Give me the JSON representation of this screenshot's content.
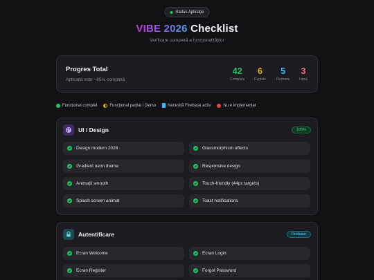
{
  "header": {
    "status_label": "Status Aplicație",
    "title_gradient": "VIBE 2026",
    "title_plain": "Checklist",
    "subtitle": "Verificare completă a funcționalităților"
  },
  "progress": {
    "title": "Progres Total",
    "subtitle": "Aplicația este ~85% completă",
    "stats": [
      {
        "value": "42",
        "label": "Complete",
        "color": "#22c55e"
      },
      {
        "value": "6",
        "label": "Parțiale",
        "color": "#eab308"
      },
      {
        "value": "5",
        "label": "Firebase",
        "color": "#38bdf8"
      },
      {
        "value": "3",
        "label": "Lipsă",
        "color": "#f87171"
      }
    ]
  },
  "legend": [
    {
      "label": "Funcțional complet",
      "icon": "green-check-icon"
    },
    {
      "label": "Funcțional parțial / Demo",
      "icon": "half-circle-icon"
    },
    {
      "label": "Necesită Firebase activ",
      "icon": "firebase-icon"
    },
    {
      "label": "Nu e implementat",
      "icon": "red-x-icon"
    }
  ],
  "sections": [
    {
      "title": "UI / Design",
      "icon": "palette-icon",
      "badge": "100%",
      "items": [
        "Design modern 2026",
        "Glassmorphism effects",
        "Gradient neon theme",
        "Responsive design",
        "Animații smooth",
        "Touch-friendly (44px targets)",
        "Splash screen animat",
        "Toast notifications"
      ]
    },
    {
      "title": "Autentificare",
      "icon": "lock-icon",
      "badge": "Firebase",
      "items": [
        "Ecran Welcome",
        "Ecran Login",
        "Ecran Register",
        "Forgot Password"
      ]
    }
  ]
}
